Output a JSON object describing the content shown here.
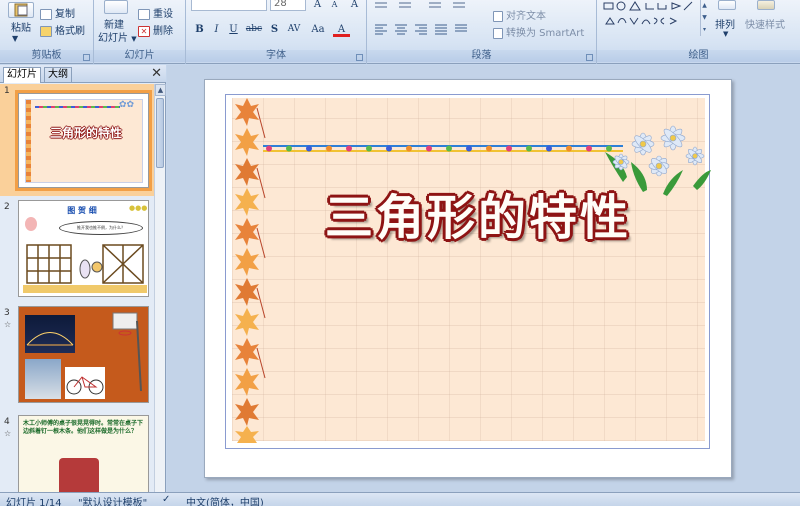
{
  "ribbon": {
    "clipboard": {
      "paste_label": "粘贴",
      "copy_label": "复制",
      "format_painter_label": "格式刷",
      "group_label": "剪贴板"
    },
    "slides": {
      "new_slide_label": "新建",
      "new_slide_label2": "幻灯片",
      "reset_label": "重设",
      "delete_label": "删除",
      "group_label": "幻灯片"
    },
    "font": {
      "size_value": "28",
      "bold": "B",
      "italic": "I",
      "underline": "U",
      "strike": "abc",
      "shadow": "S",
      "spacing": "AV",
      "case": "Aa",
      "color": "A",
      "grow": "A",
      "shrink": "A",
      "clear": "A",
      "group_label": "字体"
    },
    "paragraph": {
      "align_text_label": "对齐文本",
      "smartart_label": "转换为 SmartArt",
      "group_label": "段落"
    },
    "drawing": {
      "arrange_label": "排列",
      "quick_styles_label": "快速样式",
      "group_label": "绘图"
    }
  },
  "left_panel": {
    "tab_slides": "幻灯片",
    "tab_outline": "大纲",
    "close_glyph": "✕",
    "thumbnails": [
      {
        "num": "1",
        "title": "三角形的特性"
      },
      {
        "num": "2",
        "title": "图 贺 细",
        "bubble": "推开我也推不倒，为什么？"
      },
      {
        "num": "3"
      },
      {
        "num": "4",
        "text": "木工小师傅的桌子很晃晃得时。常常在桌子下边斜着钉一根木条。他们这样做是为什么？"
      }
    ]
  },
  "slide": {
    "title": "三角形的特性"
  },
  "status_bar": {
    "slide_count": "幻灯片 1/14",
    "theme": "\"默认设计模板\"",
    "language": "中文(简体，中国)"
  },
  "colors": {
    "ribbon_bg": "#dbe6f4",
    "selection": "#f29f46",
    "slide_paper": "#fde8d4",
    "title_outline": "#8e1414"
  }
}
